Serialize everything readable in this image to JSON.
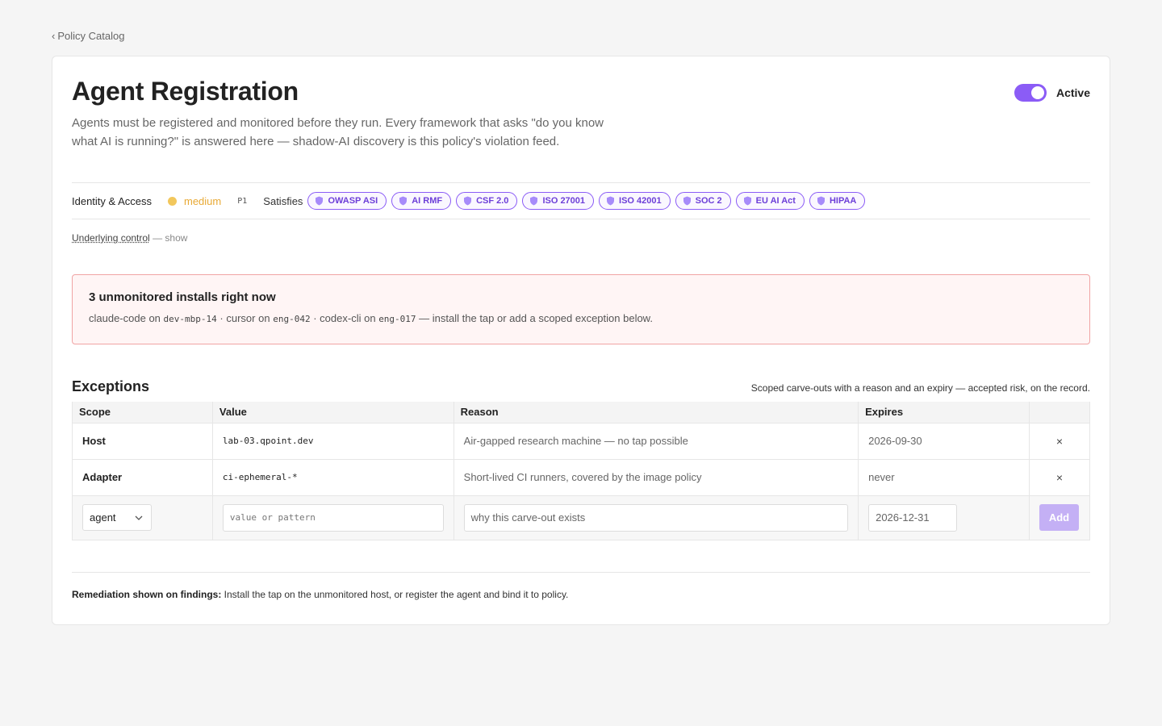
{
  "nav": {
    "back_label": "Policy Catalog",
    "back_glyph": "‹"
  },
  "policy": {
    "title": "Agent Registration",
    "status_label": "Active",
    "active": true,
    "description": "Agents must be registered and monitored before they run. Every framework that asks \"do you know what AI is running?\" is answered here — shadow-AI discovery is this policy's violation feed.",
    "category": "Identity & Access",
    "severity": "medium",
    "priority": "P1",
    "satisfies_label": "Satisfies",
    "frameworks": [
      "OWASP ASI",
      "AI RMF",
      "CSF 2.0",
      "ISO 27001",
      "ISO 42001",
      "SOC 2",
      "EU AI Act",
      "HIPAA"
    ],
    "underlying_label": "Underlying control",
    "underlying_toggle": "— show"
  },
  "alert": {
    "title": "3 unmonitored installs right now",
    "installs": [
      {
        "agent": "claude-code",
        "on": "on",
        "host": "dev-mbp-14"
      },
      {
        "agent": "cursor",
        "on": "on",
        "host": "eng-042"
      },
      {
        "agent": "codex-cli",
        "on": "on",
        "host": "eng-017"
      }
    ],
    "separator": "·",
    "suffix": "— install the tap or add a scoped exception below."
  },
  "exceptions": {
    "title": "Exceptions",
    "subtitle": "Scoped carve-outs with a reason and an expiry — accepted risk, on the record.",
    "columns": [
      "Scope",
      "Value",
      "Reason",
      "Expires"
    ],
    "rows": [
      {
        "scope": "Host",
        "value": "lab-03.qpoint.dev",
        "reason": "Air-gapped research machine — no tap possible",
        "expires": "2026-09-30"
      },
      {
        "scope": "Adapter",
        "value": "ci-ephemeral-*",
        "reason": "Short-lived CI runners, covered by the image policy",
        "expires": "never"
      }
    ],
    "new_row": {
      "scope": "agent",
      "value_placeholder": "value or pattern",
      "reason_placeholder": "why this carve-out exists",
      "expires": "2026-12-31",
      "add_label": "Add"
    },
    "remove_glyph": "×"
  },
  "remediation": {
    "label": "Remediation shown on findings:",
    "text": "Install the tap on the unmonitored host, or register the agent and bind it to policy."
  },
  "colors": {
    "accent": "#8b5cf6",
    "severity_medium": "#e8a935",
    "alert_border": "#f0a4a4",
    "alert_bg": "#fff5f5"
  }
}
